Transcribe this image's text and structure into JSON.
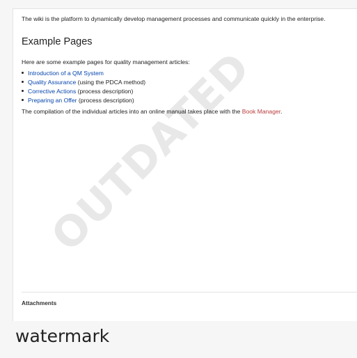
{
  "content": {
    "intro": "The wiki is the platform to dynamically develop management processes and communicate quickly in the enterprise.",
    "heading": "Example Pages",
    "lead": "Here are some example pages for quality management articles:",
    "examples": [
      {
        "link": "Introduction of a QM System",
        "suffix": ""
      },
      {
        "link": "Quality Assurance",
        "suffix": " (using the PDCA method)"
      },
      {
        "link": "Corrective Actions",
        "suffix": " (process description)"
      },
      {
        "link": "Preparing an Offer",
        "suffix": " (process description)"
      }
    ],
    "compilation": {
      "before": "The compilation of the individual articles into an online manual takes place with the ",
      "link": "Book Manager",
      "after": "."
    },
    "attachments_label": "Attachments"
  },
  "watermark": {
    "text": "OUTDATED"
  },
  "caption": "watermark",
  "colors": {
    "link": "#0645ad",
    "missing_link": "#ba3b3b",
    "page_background": "#f6f6f6"
  }
}
